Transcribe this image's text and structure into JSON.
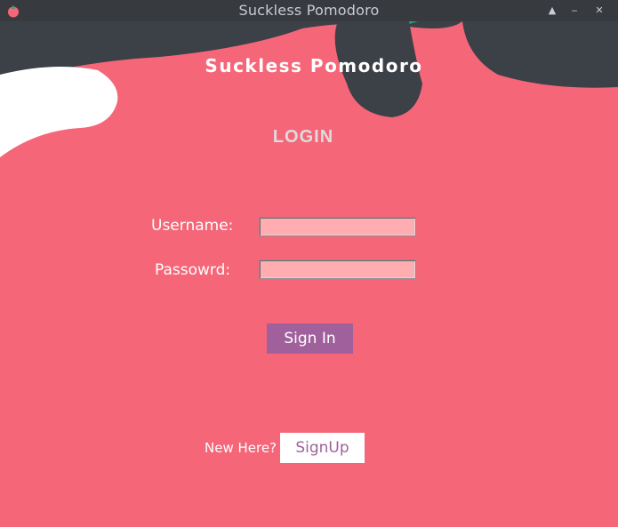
{
  "window": {
    "title": "Suckless Pomodoro",
    "controls": {
      "shade": "▲",
      "minimize": "‒",
      "close": "✕"
    }
  },
  "app": {
    "title": "Suckless Pomodoro",
    "heading": "LOGIN"
  },
  "form": {
    "username_label": "Username:",
    "username_value": "",
    "password_label": "Passowrd:",
    "password_value": "",
    "signin_label": "Sign In"
  },
  "footer": {
    "prompt": "New Here?",
    "signup_label": "SignUp"
  },
  "colors": {
    "background_dark": "#3c4047",
    "tomato": "#f56678",
    "leaf": "#2e9c7b",
    "field_bg": "#ffadb1",
    "button_purple": "#a0609c",
    "white": "#ffffff"
  }
}
